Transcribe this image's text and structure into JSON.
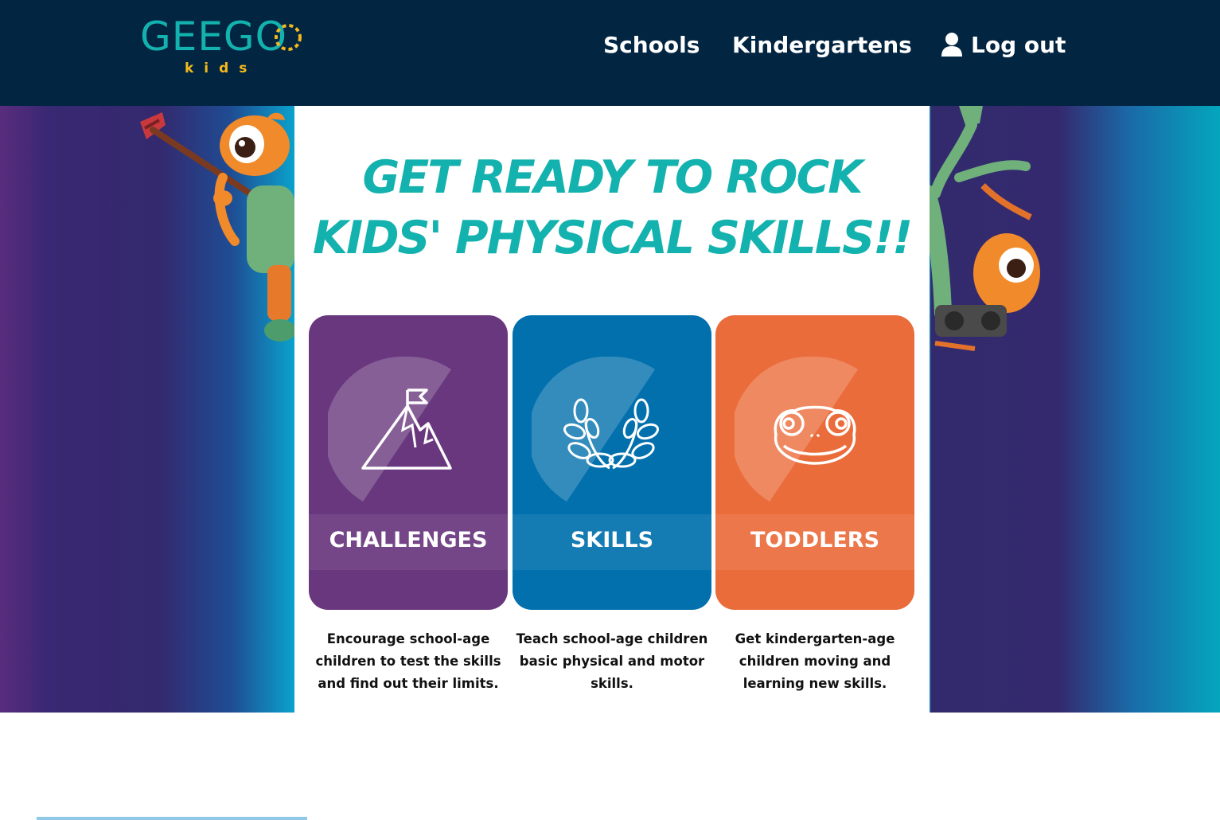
{
  "header": {
    "logo": {
      "wordmark": "GEEGO",
      "sub": "kids"
    },
    "nav": {
      "schools": "Schools",
      "kindergartens": "Kindergartens",
      "logout": "Log out"
    }
  },
  "hero": {
    "headline_line1": "GET READY TO ROCK",
    "headline_line2": "KIDS' PHYSICAL SKILLS!!"
  },
  "cards": [
    {
      "title": "CHALLENGES",
      "icon": "mountain-flag-icon",
      "color": "#69377e",
      "description": "Encourage school-age children to test the skills and find out their limits."
    },
    {
      "title": "SKILLS",
      "icon": "laurel-wreath-icon",
      "color": "#0270ad",
      "description": "Teach school-age children basic physical and motor skills."
    },
    {
      "title": "TODDLERS",
      "icon": "gecko-face-icon",
      "color": "#eb6c3b",
      "description": "Get kindergarten-age children moving and learning new skills."
    }
  ],
  "colors": {
    "header_bg": "#022542",
    "brand_teal": "#14b2ae",
    "brand_yellow": "#f4b81c"
  }
}
